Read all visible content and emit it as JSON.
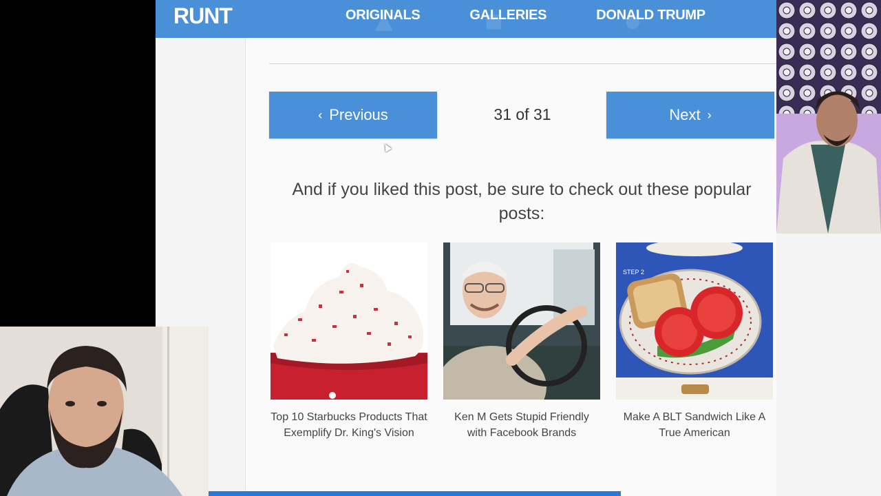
{
  "nav": {
    "logo": "RUNT",
    "links": [
      "ORIGINALS",
      "GALLERIES",
      "DONALD TRUMP"
    ]
  },
  "pager": {
    "previous_label": "Previous",
    "next_label": "Next",
    "count": "31 of 31"
  },
  "promo": {
    "text": "And if you liked this post, be sure to check out these popular posts:"
  },
  "cards": [
    {
      "caption": "Top 10 Starbucks Products That Exemplify Dr. King's Vision"
    },
    {
      "caption": "Ken M Gets Stupid Friendly with Facebook Brands"
    },
    {
      "caption": "Make A BLT Sandwich Like A True American",
      "badge": "STEP 2"
    }
  ],
  "colors": {
    "accent": "#4a90d9",
    "bottombar": "#2b78d8"
  }
}
